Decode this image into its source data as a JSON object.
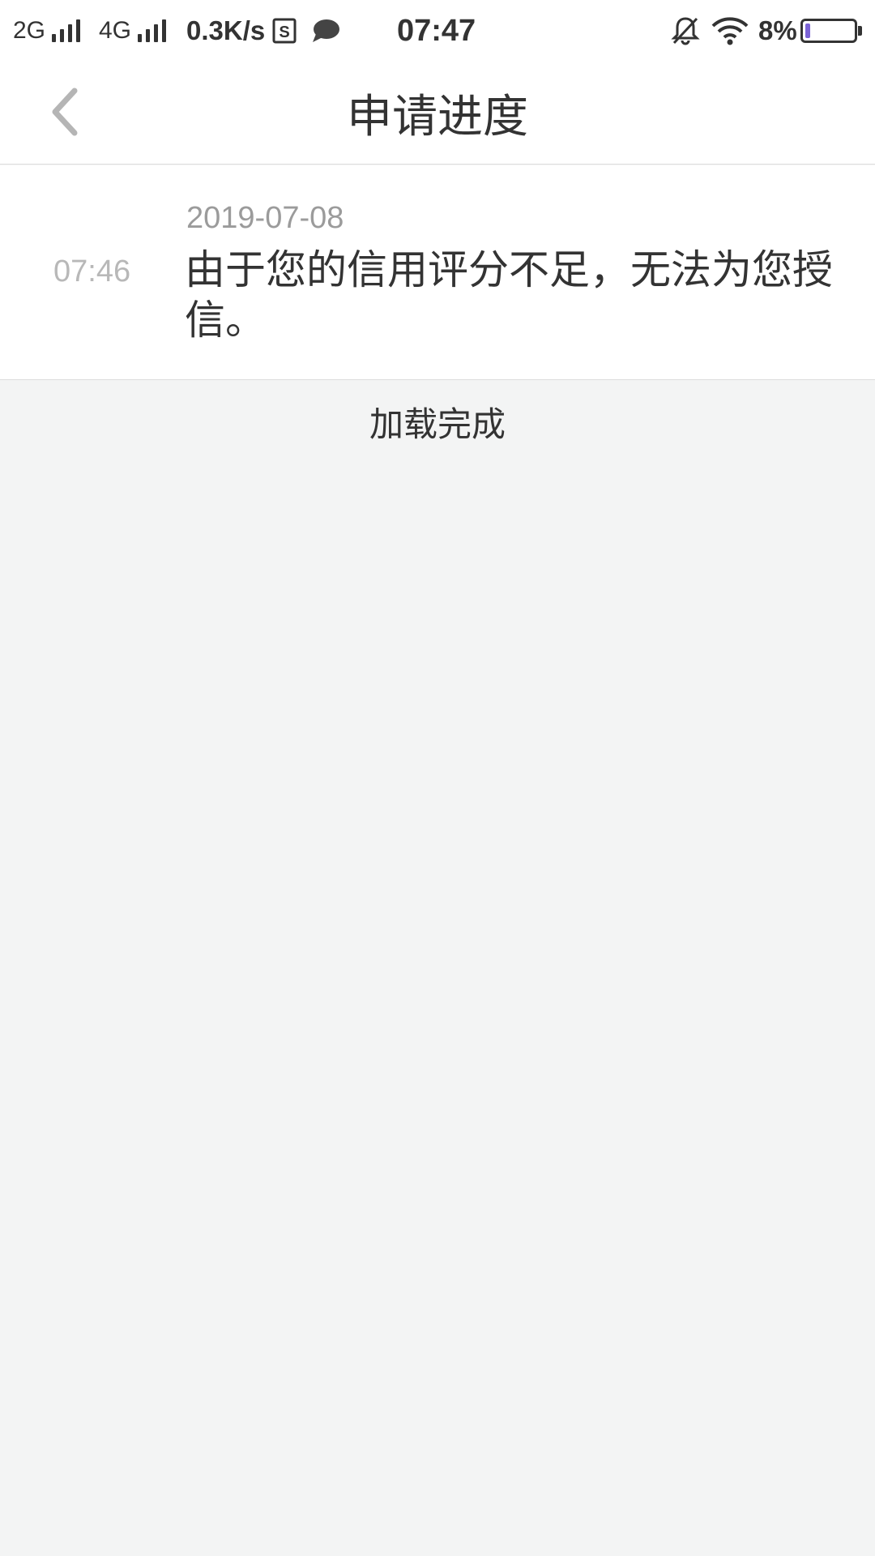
{
  "status_bar": {
    "network_1": "2G",
    "network_2": "4G",
    "speed": "0.3K/s",
    "sim_icon": "sim-s-icon",
    "message_icon": "chat-bubble-icon",
    "clock": "07:47",
    "mute_icon": "bell-off-icon",
    "wifi_icon": "wifi-icon",
    "battery_percent": "8%",
    "battery_level": 0.08,
    "battery_color": "#7b63d6"
  },
  "nav": {
    "back_icon": "chevron-left-icon",
    "title": "申请进度"
  },
  "records": [
    {
      "date": "2019-07-08",
      "time": "07:46",
      "message": "由于您的信用评分不足，无法为您授信。"
    }
  ],
  "list_footer": {
    "status": "加载完成"
  }
}
